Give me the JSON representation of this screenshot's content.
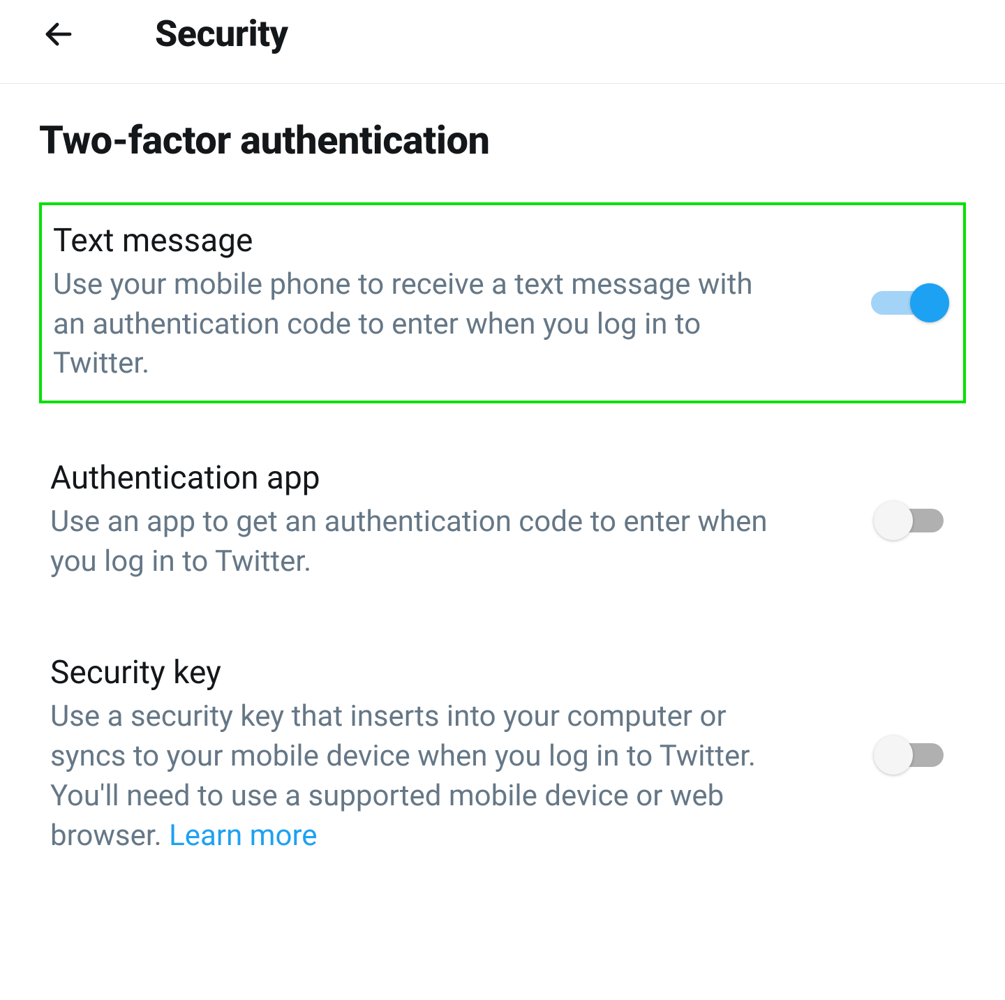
{
  "header": {
    "title": "Security"
  },
  "section": {
    "title": "Two-factor authentication"
  },
  "options": [
    {
      "title": "Text message",
      "desc": "Use your mobile phone to receive a text message with an authentication code to enter when you log in to Twitter.",
      "enabled": true,
      "highlighted": true
    },
    {
      "title": "Authentication app",
      "desc": "Use an app to get an authentication code to enter when you log in to Twitter.",
      "enabled": false,
      "highlighted": false
    },
    {
      "title": "Security key",
      "desc": "Use a security key that inserts into your computer or syncs to your mobile device when you log in to Twitter. You'll need to use a supported mobile device or web browser. ",
      "learn_more": "Learn more",
      "enabled": false,
      "highlighted": false
    }
  ]
}
